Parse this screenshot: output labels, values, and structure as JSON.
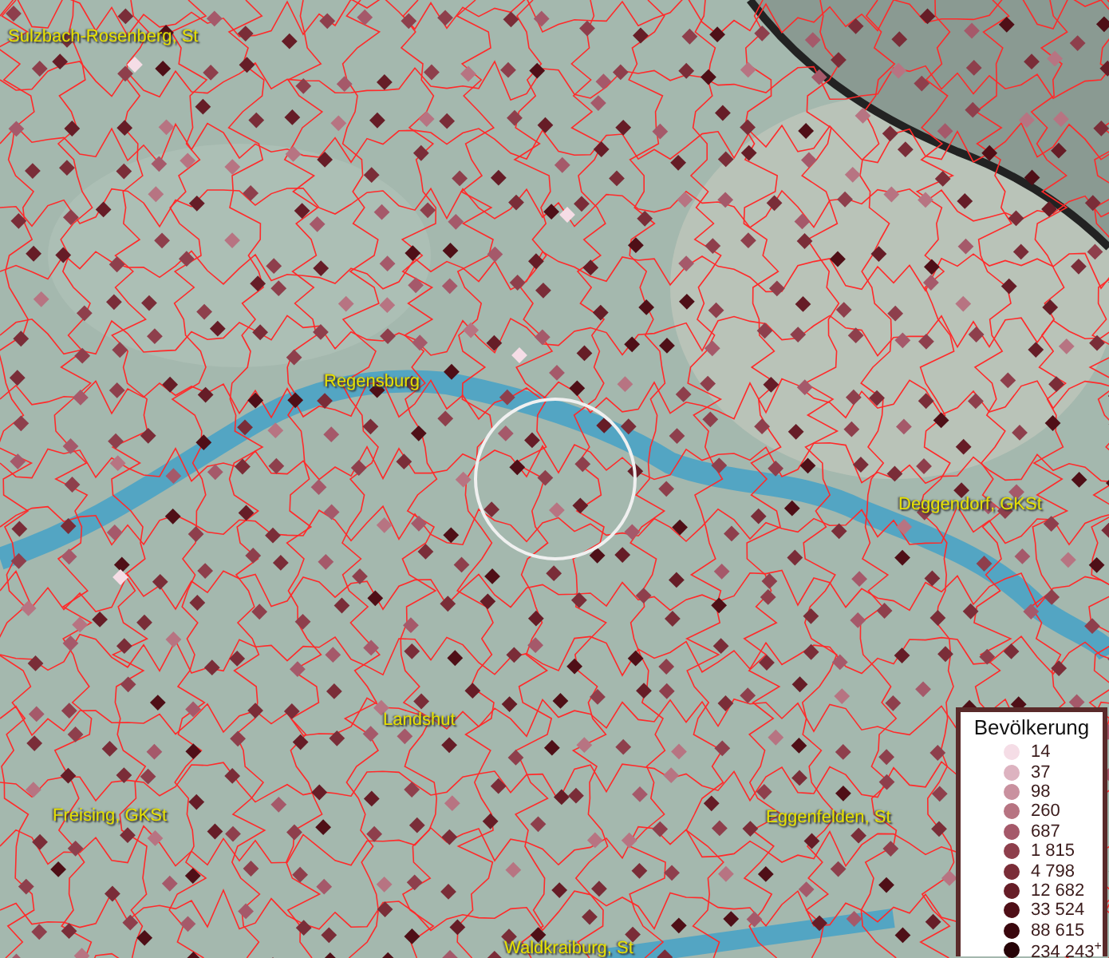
{
  "map": {
    "places": [
      {
        "label": "Sulzbach-Rosenberg, St"
      },
      {
        "label": "Regensburg"
      },
      {
        "label": "Deggendorf, GKSt"
      },
      {
        "label": "Landshut"
      },
      {
        "label": "Freising, GKSt"
      },
      {
        "label": "Eggenfelden, St"
      },
      {
        "label": "Waldkraiburg, St"
      }
    ]
  },
  "legend": {
    "title": "Bevölkerung",
    "classes": [
      {
        "label": "14",
        "color": "#f5dde6"
      },
      {
        "label": "37",
        "color": "#ddb3c0"
      },
      {
        "label": "98",
        "color": "#c9919f"
      },
      {
        "label": "260",
        "color": "#b77482"
      },
      {
        "label": "687",
        "color": "#a5596a"
      },
      {
        "label": "1 815",
        "color": "#8e3f4c"
      },
      {
        "label": "4 798",
        "color": "#7a2d38"
      },
      {
        "label": "12 682",
        "color": "#661d27"
      },
      {
        "label": "33 524",
        "color": "#4f0f17"
      },
      {
        "label": "88 615",
        "color": "#3a070d"
      },
      {
        "label": "234 243$^{+}$",
        "color": "#260307"
      }
    ]
  }
}
